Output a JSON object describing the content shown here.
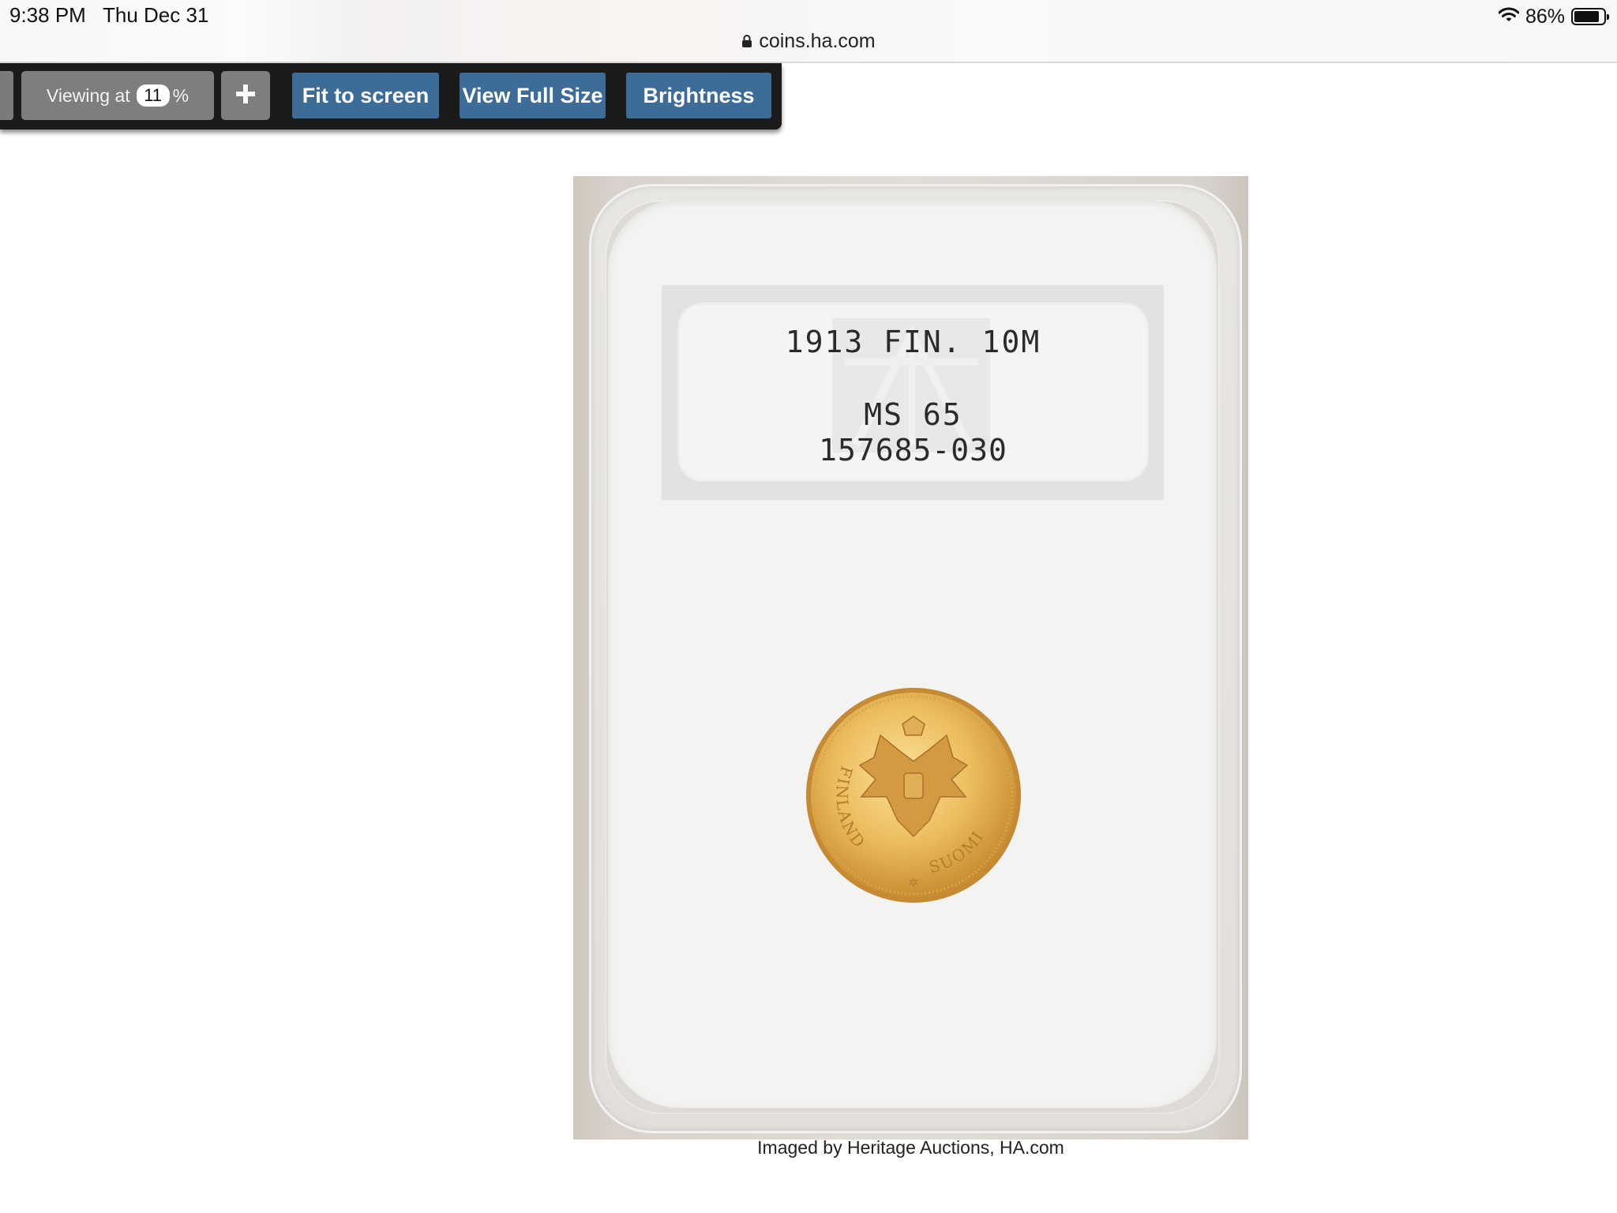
{
  "status_bar": {
    "time": "9:38 PM",
    "date": "Thu Dec 31",
    "url": "coins.ha.com",
    "battery_percent": "86%",
    "battery_level": 0.86,
    "icons": [
      "lock-icon",
      "wifi-icon",
      "battery-icon"
    ]
  },
  "toolbar": {
    "viewing_prefix": "Viewing at",
    "zoom_value": "11",
    "zoom_suffix": "%",
    "fit_label": "Fit to screen",
    "full_size_label": "View Full Size",
    "brightness_label": "Brightness",
    "button_color": "#3e6c99",
    "icons": [
      "minus-icon",
      "plus-icon"
    ]
  },
  "slab_label": {
    "title": "1913 FIN. 10M",
    "grade": "MS 65",
    "cert_number": "157685-030"
  },
  "coin": {
    "left_legend": "FINLAND",
    "right_legend": "SUOMI",
    "color": "#e6b85a"
  },
  "caption": "Imaged by Heritage Auctions, HA.com"
}
